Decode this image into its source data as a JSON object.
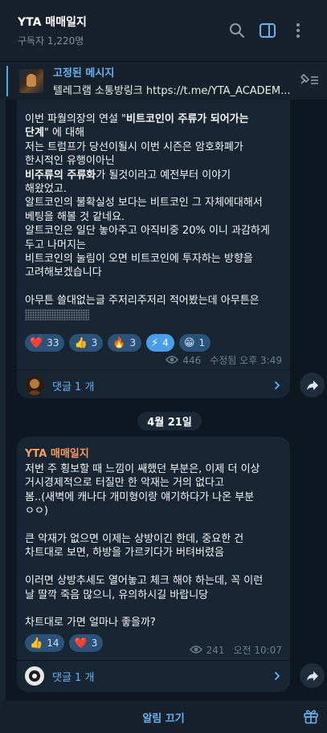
{
  "header": {
    "title": "YTA 매매일지",
    "subtitle": "구독자 1,220명"
  },
  "pinned": {
    "title": "고정된 메시지",
    "text": "텔레그램 소통방링크 https://t.me/YTA_ACADEM..."
  },
  "post1": {
    "lines": [
      {
        "parts": [
          {
            "t": "이번 파월의장의 연설 \""
          },
          {
            "t": "비트코인이 주류가 되어가는",
            "b": true
          }
        ]
      },
      {
        "parts": [
          {
            "t": "단계",
            "b": true
          },
          {
            "t": "\" 에 대해"
          }
        ]
      },
      {
        "parts": [
          {
            "t": "저는 트럼프가 당선이될시 이번 시즌은 암호화폐가"
          }
        ]
      },
      {
        "parts": [
          {
            "t": "한시적인 유행이아닌"
          }
        ]
      },
      {
        "parts": [
          {
            "t": "비주류의 주류화",
            "b": true
          },
          {
            "t": "가 될것이라고 예전부터 이야기"
          }
        ]
      },
      {
        "parts": [
          {
            "t": "해왔었고."
          }
        ]
      },
      {
        "parts": [
          {
            "t": "알트코인의 불확실성 보다는 비트코인 그 자체에대해서"
          }
        ]
      },
      {
        "parts": [
          {
            "t": "베팅을 해볼 것 같네요."
          }
        ]
      },
      {
        "parts": [
          {
            "t": "알트코인은 일단 놓아주고 아직비중 20% 이니 과감하게"
          }
        ]
      },
      {
        "parts": [
          {
            "t": "두고 나머지는"
          }
        ]
      },
      {
        "parts": [
          {
            "t": "비트코인의 눌림이 오면 비트코인에 투자하는 방향을"
          }
        ]
      },
      {
        "parts": [
          {
            "t": "고려해보겠습니다"
          }
        ]
      },
      {
        "parts": []
      },
      {
        "parts": [
          {
            "t": "아무튼 쓸대없는글 주저리주저리 적어봤는데 아무튼은"
          }
        ]
      },
      {
        "parts": [
          {
            "spoiler": true
          }
        ]
      }
    ],
    "reactions": [
      {
        "emoji": "❤️",
        "count": "33",
        "active": false
      },
      {
        "emoji": "👍",
        "count": "3",
        "active": false
      },
      {
        "emoji": "🔥",
        "count": "3",
        "active": false
      },
      {
        "emoji": "⚡",
        "count": "4",
        "active": true
      },
      {
        "emoji": "😁",
        "count": "1",
        "active": false
      }
    ],
    "views": "446",
    "edited_time": "수정됨 오후 3:49",
    "comments_label": "댓글 1 개"
  },
  "date_label": "4월 21일",
  "post2": {
    "sender": "YTA 매매일지",
    "lines": [
      "저번 주 횡보할 때 느낌이 쌔했던 부분은, 이제 더 이상",
      "거시경제적으로 터질만 한 악재는 거의 없다고",
      "봄..(새벽에 캐나다 개미형이랑 얘기하다가 나온 부분",
      "ㅇㅇ)",
      "",
      "큰 악재가 없으면 이제는 상방이긴 한데, 중요한 건",
      "차트대로 보면, 하방을 가르키다가 버텨버렸음",
      "",
      "이러면 상방추세도 열어놓고 체크 해야 하는데, 꼭 이런",
      "날 딸깍 죽음 많으니, 유의하시길 바랍니당",
      "",
      "차트대로 가면 얼마나 좋을까?"
    ],
    "reactions": [
      {
        "emoji": "👍",
        "count": "14",
        "active": false
      },
      {
        "emoji": "❤️",
        "count": "3",
        "active": false
      }
    ],
    "views": "241",
    "time": "오전 10:07",
    "comments_label": "댓글 1 개"
  },
  "footer": {
    "mute_label": "알림 끄기"
  }
}
